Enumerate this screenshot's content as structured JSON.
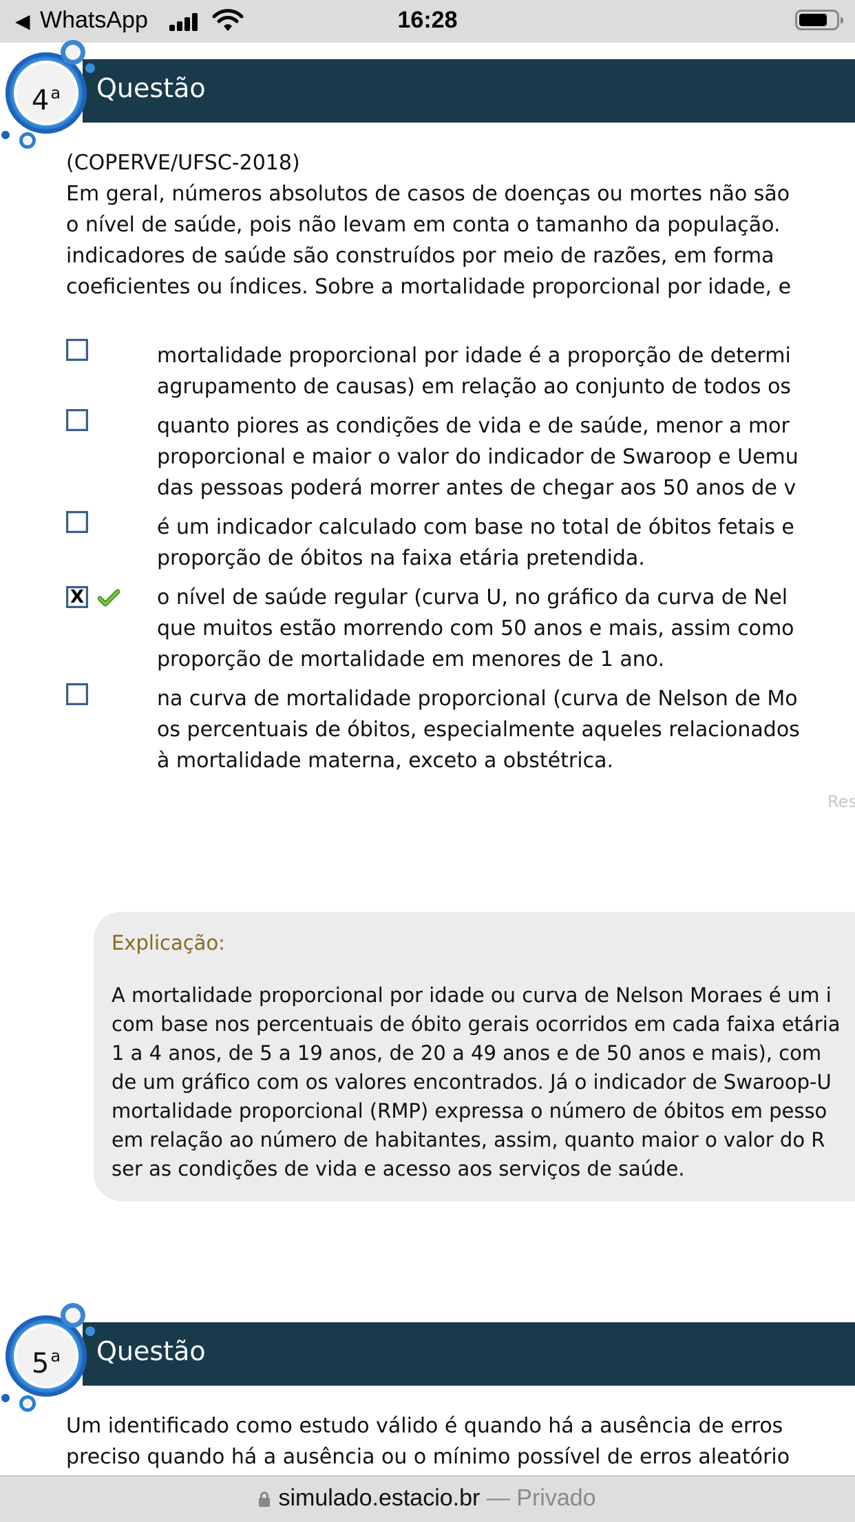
{
  "status_bar": {
    "back_app": "WhatsApp",
    "time": "16:28",
    "icons": [
      "back-arrow-icon",
      "signal-icon",
      "wifi-icon",
      "battery-icon"
    ]
  },
  "question4": {
    "number": "4",
    "ordinal": "a",
    "header": "Questão",
    "source": "(COPERVE/UFSC-2018)",
    "statement_lines": [
      "Em geral, números absolutos de casos de doenças ou mortes não são",
      "o nível de saúde, pois não levam em conta o tamanho da população.",
      "indicadores de saúde são construídos por meio de razões, em forma",
      "coeficientes ou índices. Sobre a mortalidade proporcional por idade, e"
    ],
    "options": [
      {
        "checked": false,
        "correct": false,
        "lines": [
          "mortalidade proporcional por idade é a proporção de determi",
          "agrupamento de causas) em relação ao conjunto de todos os"
        ]
      },
      {
        "checked": false,
        "correct": false,
        "lines": [
          "quanto piores as condições de vida e de saúde, menor a mor",
          "proporcional e maior o valor do indicador de Swaroop e Uemu",
          "das pessoas poderá morrer antes de chegar aos 50 anos de v"
        ]
      },
      {
        "checked": false,
        "correct": false,
        "lines": [
          "é um indicador calculado com base no total de óbitos fetais e",
          "proporção de óbitos na faixa etária pretendida."
        ]
      },
      {
        "checked": true,
        "checked_glyph": "X",
        "correct": true,
        "lines": [
          "o nível de saúde regular (curva U, no gráfico da curva de Nel",
          "que muitos estão morrendo com 50 anos e mais, assim como",
          "proporção de mortalidade em menores de 1 ano."
        ]
      },
      {
        "checked": false,
        "correct": false,
        "lines": [
          "na curva de mortalidade proporcional (curva de Nelson de Mo",
          "os percentuais de óbitos, especialmente aqueles relacionados",
          "à mortalidade materna, exceto a obstétrica."
        ]
      }
    ],
    "response_label": "Res",
    "explanation": {
      "label": "Explicação:",
      "lines": [
        "A mortalidade proporcional por idade ou curva de Nelson Moraes é um i",
        "com base nos percentuais de óbito gerais ocorridos em cada faixa etária",
        "1 a 4 anos, de 5 a 19 anos, de 20 a 49 anos e de 50 anos e mais), com",
        "de um gráfico com os valores encontrados. Já o indicador de Swaroop-U",
        "mortalidade proporcional (RMP) expressa o número de óbitos em pesso",
        "em relação ao número de habitantes, assim, quanto maior o valor do R",
        "ser as condições de vida e acesso aos serviços de saúde."
      ]
    }
  },
  "question5": {
    "number": "5",
    "ordinal": "a",
    "header": "Questão",
    "statement_lines": [
      "Um identificado como estudo válido é quando há a ausência de erros",
      "preciso quando há a ausência ou o mínimo possível de erros aleatório"
    ]
  },
  "browser_bar": {
    "domain": "simulado.estacio.br",
    "separator": " — ",
    "mode": "Privado"
  },
  "colors": {
    "header_bg": "#183a4b",
    "explanation_label": "#8a6a1c",
    "correct_check": "#6cc83a"
  }
}
